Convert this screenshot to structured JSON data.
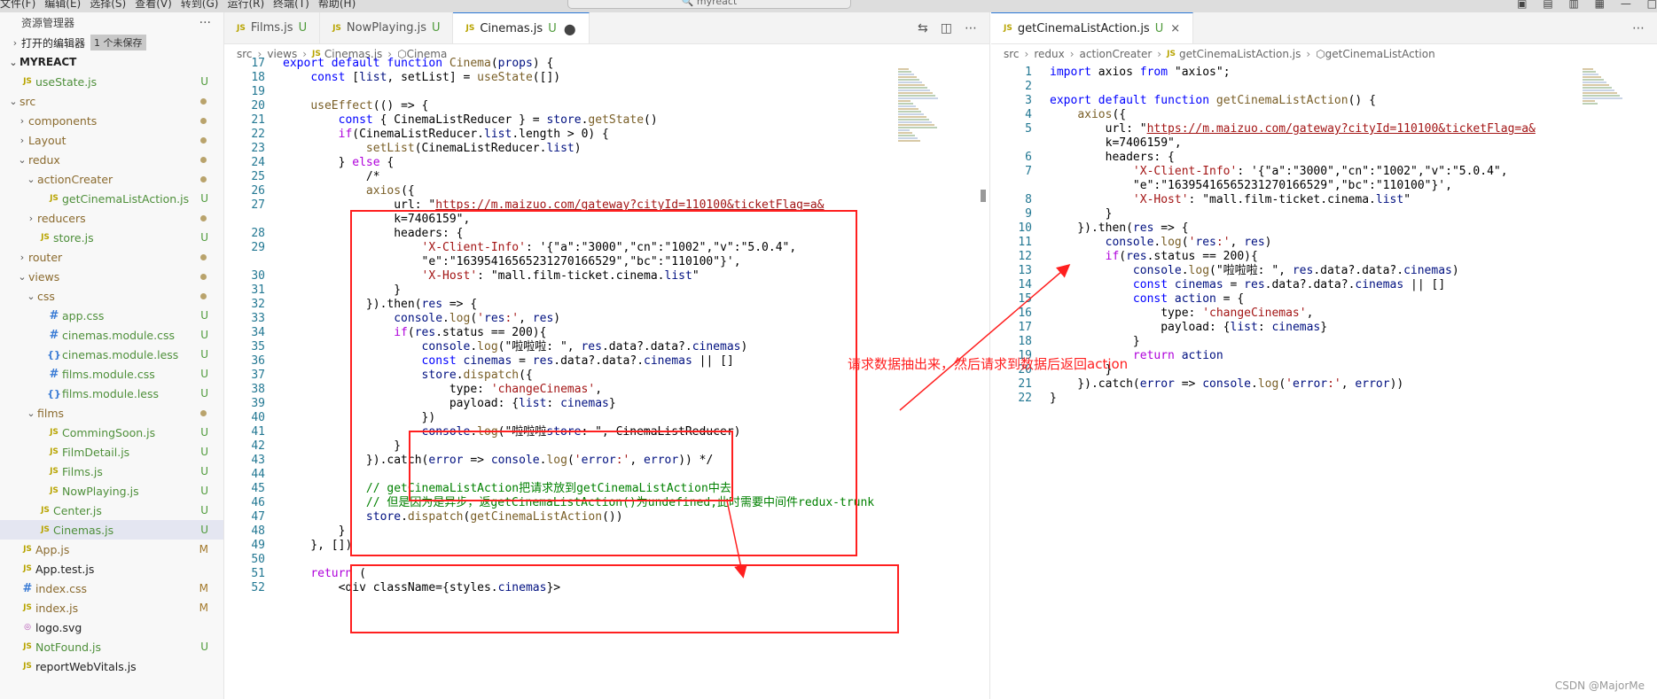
{
  "titlebar": {
    "menus": [
      "文件(F)",
      "编辑(E)",
      "选择(S)",
      "查看(V)",
      "转到(G)",
      "运行(R)",
      "终端(T)",
      "帮助(H)"
    ],
    "search": "myreact"
  },
  "sidebar": {
    "header": "资源管理器",
    "more": "···",
    "open_editors": "打开的编辑器",
    "unsaved": "1 个未保存",
    "project": "MYREACT",
    "tree": [
      {
        "label": "useState.js",
        "kind": "js",
        "indent": 1,
        "badge": "U"
      },
      {
        "label": "src",
        "kind": "folder",
        "open": true,
        "indent": 1,
        "dot": true
      },
      {
        "label": "components",
        "kind": "folder",
        "open": false,
        "indent": 2,
        "dot": true
      },
      {
        "label": "Layout",
        "kind": "folder",
        "open": false,
        "indent": 2,
        "dot": true
      },
      {
        "label": "redux",
        "kind": "folder",
        "open": true,
        "indent": 2,
        "dot": true
      },
      {
        "label": "actionCreater",
        "kind": "folder",
        "open": true,
        "indent": 3,
        "dot": true
      },
      {
        "label": "getCinemaListAction.js",
        "kind": "js",
        "indent": 4,
        "badge": "U"
      },
      {
        "label": "reducers",
        "kind": "folder",
        "open": false,
        "indent": 3,
        "dot": true
      },
      {
        "label": "store.js",
        "kind": "js",
        "indent": 3,
        "badge": "U"
      },
      {
        "label": "router",
        "kind": "folder",
        "open": false,
        "indent": 2,
        "dot": true
      },
      {
        "label": "views",
        "kind": "folder",
        "open": true,
        "indent": 2,
        "dot": true
      },
      {
        "label": "css",
        "kind": "folder",
        "open": true,
        "indent": 3,
        "dot": true
      },
      {
        "label": "app.css",
        "kind": "css",
        "indent": 4,
        "badge": "U"
      },
      {
        "label": "cinemas.module.css",
        "kind": "css",
        "indent": 4,
        "badge": "U"
      },
      {
        "label": "cinemas.module.less",
        "kind": "less",
        "indent": 4,
        "badge": "U"
      },
      {
        "label": "films.module.css",
        "kind": "css",
        "indent": 4,
        "badge": "U"
      },
      {
        "label": "films.module.less",
        "kind": "less",
        "indent": 4,
        "badge": "U"
      },
      {
        "label": "films",
        "kind": "folder",
        "open": true,
        "indent": 3,
        "dot": true
      },
      {
        "label": "CommingSoon.js",
        "kind": "js",
        "indent": 4,
        "badge": "U"
      },
      {
        "label": "FilmDetail.js",
        "kind": "js",
        "indent": 4,
        "badge": "U"
      },
      {
        "label": "Films.js",
        "kind": "js",
        "indent": 4,
        "badge": "U"
      },
      {
        "label": "NowPlaying.js",
        "kind": "js",
        "indent": 4,
        "badge": "U"
      },
      {
        "label": "Center.js",
        "kind": "js",
        "indent": 3,
        "badge": "U"
      },
      {
        "label": "Cinemas.js",
        "kind": "js",
        "indent": 3,
        "badge": "U",
        "selected": true
      },
      {
        "label": "App.js",
        "kind": "js",
        "indent": 1,
        "badge": "M"
      },
      {
        "label": "App.test.js",
        "kind": "js",
        "indent": 1,
        "badge": ""
      },
      {
        "label": "index.css",
        "kind": "css",
        "indent": 1,
        "badge": "M"
      },
      {
        "label": "index.js",
        "kind": "js",
        "indent": 1,
        "badge": "M"
      },
      {
        "label": "logo.svg",
        "kind": "svg",
        "indent": 1,
        "badge": ""
      },
      {
        "label": "NotFound.js",
        "kind": "js",
        "indent": 1,
        "badge": "U"
      },
      {
        "label": "reportWebVitals.js",
        "kind": "js",
        "indent": 1,
        "badge": ""
      }
    ]
  },
  "left_editor": {
    "tabs": [
      {
        "label": "Films.js",
        "badge": "U",
        "active": false
      },
      {
        "label": "NowPlaying.js",
        "badge": "U",
        "active": false
      },
      {
        "label": "Cinemas.js",
        "badge": "U",
        "active": true,
        "modified": true
      }
    ],
    "breadcrumb": [
      "src",
      "views",
      "Cinemas.js",
      "Cinema"
    ],
    "lines": [
      {
        "n": "17",
        "t": "export default function Cinema(props) {"
      },
      {
        "n": "18",
        "t": "    const [list, setList] = useState([])"
      },
      {
        "n": "19",
        "t": ""
      },
      {
        "n": "20",
        "t": "    useEffect(() => {"
      },
      {
        "n": "21",
        "t": "        const { CinemaListReducer } = store.getState()"
      },
      {
        "n": "22",
        "t": "        if(CinemaListReducer.list.length > 0) {"
      },
      {
        "n": "23",
        "t": "            setList(CinemaListReducer.list)"
      },
      {
        "n": "24",
        "t": "        } else {"
      },
      {
        "n": "25",
        "t": "            /*"
      },
      {
        "n": "26",
        "t": "            axios({"
      },
      {
        "n": "27",
        "t": "                url: \"https://m.maizuo.com/gateway?cityId=110100&ticketFlag=a&"
      },
      {
        "n": "",
        "t": "                k=7406159\","
      },
      {
        "n": "28",
        "t": "                headers: {"
      },
      {
        "n": "29",
        "t": "                    'X-Client-Info': '{\"a\":\"3000\",\"cn\":\"1002\",\"v\":\"5.0.4\","
      },
      {
        "n": "",
        "t": "                    \"e\":\"16395416565231270166529\",\"bc\":\"110100\"}',"
      },
      {
        "n": "30",
        "t": "                    'X-Host': \"mall.film-ticket.cinema.list\""
      },
      {
        "n": "31",
        "t": "                }"
      },
      {
        "n": "32",
        "t": "            }).then(res => {"
      },
      {
        "n": "33",
        "t": "                console.log('res:', res)"
      },
      {
        "n": "34",
        "t": "                if(res.status == 200){"
      },
      {
        "n": "35",
        "t": "                    console.log(\"啦啦啦: \", res.data?.data?.cinemas)"
      },
      {
        "n": "36",
        "t": "                    const cinemas = res.data?.data?.cinemas || []"
      },
      {
        "n": "37",
        "t": "                    store.dispatch({"
      },
      {
        "n": "38",
        "t": "                        type: 'changeCinemas',"
      },
      {
        "n": "39",
        "t": "                        payload: {list: cinemas}"
      },
      {
        "n": "40",
        "t": "                    })"
      },
      {
        "n": "41",
        "t": "                    console.log(\"啦啦啦store: \", CinemaListReducer)"
      },
      {
        "n": "42",
        "t": "                }"
      },
      {
        "n": "43",
        "t": "            }).catch(error => console.log('error:', error)) */"
      },
      {
        "n": "44",
        "t": ""
      },
      {
        "n": "45",
        "t": "            // getCinemaListAction把请求放到getCinemaListAction中去"
      },
      {
        "n": "46",
        "t": "            // 但是因为是异步，返getCinemaListAction()为undefined,此时需要中间件redux-trunk"
      },
      {
        "n": "47",
        "t": "            store.dispatch(getCinemaListAction())"
      },
      {
        "n": "48",
        "t": "        }"
      },
      {
        "n": "49",
        "t": "    }, [])"
      },
      {
        "n": "50",
        "t": ""
      },
      {
        "n": "51",
        "t": "    return ("
      },
      {
        "n": "52",
        "t": "        <div className={styles.cinemas}>"
      }
    ]
  },
  "right_editor": {
    "tabs": [
      {
        "label": "getCinemaListAction.js",
        "badge": "U",
        "active": true
      }
    ],
    "breadcrumb": [
      "src",
      "redux",
      "actionCreater",
      "getCinemaListAction.js",
      "getCinemaListAction"
    ],
    "lines": [
      {
        "n": "1",
        "t": "import axios from \"axios\";"
      },
      {
        "n": "2",
        "t": ""
      },
      {
        "n": "3",
        "t": "export default function getCinemaListAction() {"
      },
      {
        "n": "4",
        "t": "    axios({"
      },
      {
        "n": "5",
        "t": "        url: \"https://m.maizuo.com/gateway?cityId=110100&ticketFlag=a&"
      },
      {
        "n": "",
        "t": "        k=7406159\","
      },
      {
        "n": "6",
        "t": "        headers: {"
      },
      {
        "n": "7",
        "t": "            'X-Client-Info': '{\"a\":\"3000\",\"cn\":\"1002\",\"v\":\"5.0.4\","
      },
      {
        "n": "",
        "t": "            \"e\":\"16395416565231270166529\",\"bc\":\"110100\"}',"
      },
      {
        "n": "8",
        "t": "            'X-Host': \"mall.film-ticket.cinema.list\""
      },
      {
        "n": "9",
        "t": "        }"
      },
      {
        "n": "10",
        "t": "    }).then(res => {"
      },
      {
        "n": "11",
        "t": "        console.log('res:', res)"
      },
      {
        "n": "12",
        "t": "        if(res.status == 200){"
      },
      {
        "n": "13",
        "t": "            console.log(\"啦啦啦: \", res.data?.data?.cinemas)"
      },
      {
        "n": "14",
        "t": "            const cinemas = res.data?.data?.cinemas || []"
      },
      {
        "n": "15",
        "t": "            const action = {"
      },
      {
        "n": "16",
        "t": "                type: 'changeCinemas',"
      },
      {
        "n": "17",
        "t": "                payload: {list: cinemas}"
      },
      {
        "n": "18",
        "t": "            }"
      },
      {
        "n": "19",
        "t": "            return action"
      },
      {
        "n": "20",
        "t": "        }"
      },
      {
        "n": "21",
        "t": "    }).catch(error => console.log('error:', error))"
      },
      {
        "n": "22",
        "t": "}"
      }
    ]
  },
  "annotation": "请求数据抽出来，然后请求到数据后返回action",
  "watermark": "CSDN @MajorMe",
  "colors": {
    "accent": "#2a77d6",
    "annotation": "#ff1f1f"
  }
}
